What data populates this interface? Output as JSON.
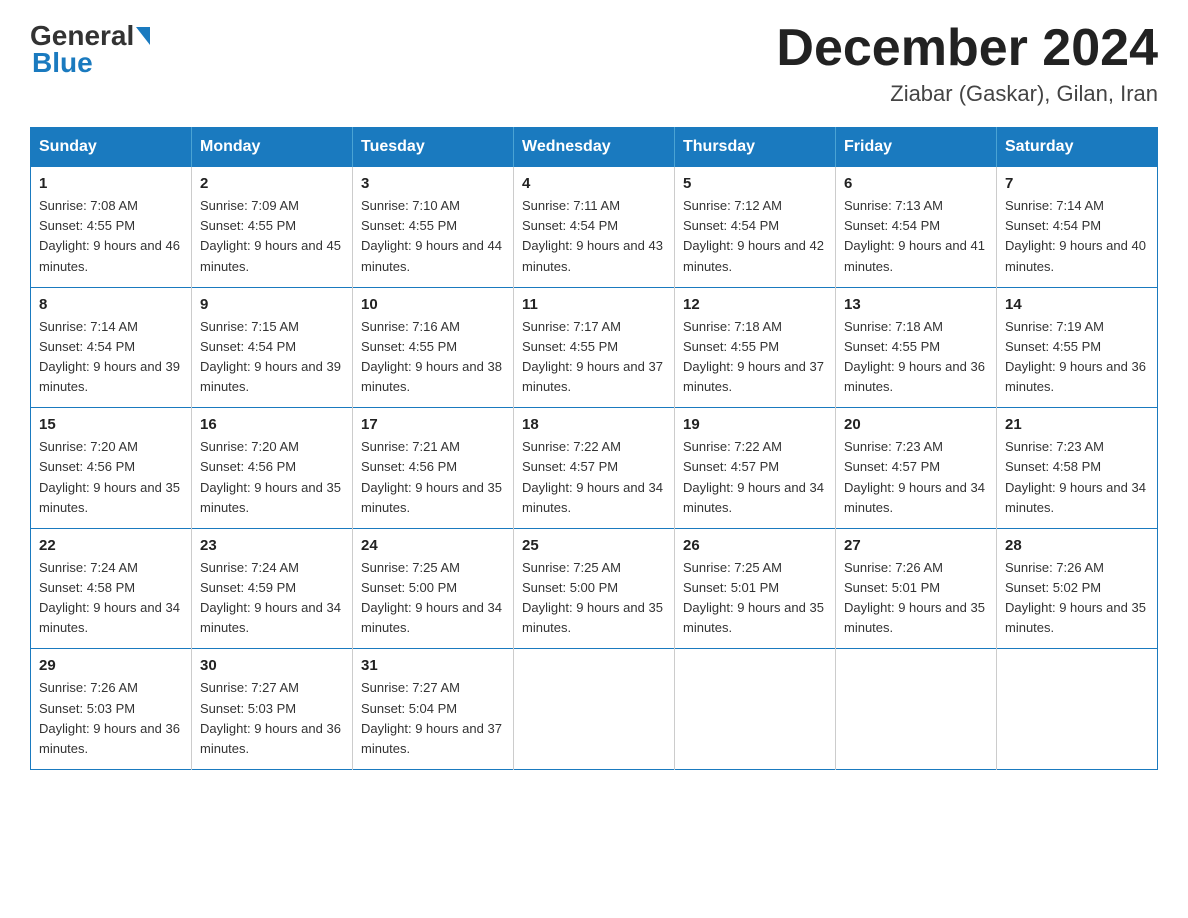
{
  "header": {
    "logo_general": "General",
    "logo_blue": "Blue",
    "month_title": "December 2024",
    "location": "Ziabar (Gaskar), Gilan, Iran"
  },
  "days_of_week": [
    "Sunday",
    "Monday",
    "Tuesday",
    "Wednesday",
    "Thursday",
    "Friday",
    "Saturday"
  ],
  "weeks": [
    [
      {
        "day": "1",
        "sunrise": "7:08 AM",
        "sunset": "4:55 PM",
        "daylight": "9 hours and 46 minutes."
      },
      {
        "day": "2",
        "sunrise": "7:09 AM",
        "sunset": "4:55 PM",
        "daylight": "9 hours and 45 minutes."
      },
      {
        "day": "3",
        "sunrise": "7:10 AM",
        "sunset": "4:55 PM",
        "daylight": "9 hours and 44 minutes."
      },
      {
        "day": "4",
        "sunrise": "7:11 AM",
        "sunset": "4:54 PM",
        "daylight": "9 hours and 43 minutes."
      },
      {
        "day": "5",
        "sunrise": "7:12 AM",
        "sunset": "4:54 PM",
        "daylight": "9 hours and 42 minutes."
      },
      {
        "day": "6",
        "sunrise": "7:13 AM",
        "sunset": "4:54 PM",
        "daylight": "9 hours and 41 minutes."
      },
      {
        "day": "7",
        "sunrise": "7:14 AM",
        "sunset": "4:54 PM",
        "daylight": "9 hours and 40 minutes."
      }
    ],
    [
      {
        "day": "8",
        "sunrise": "7:14 AM",
        "sunset": "4:54 PM",
        "daylight": "9 hours and 39 minutes."
      },
      {
        "day": "9",
        "sunrise": "7:15 AM",
        "sunset": "4:54 PM",
        "daylight": "9 hours and 39 minutes."
      },
      {
        "day": "10",
        "sunrise": "7:16 AM",
        "sunset": "4:55 PM",
        "daylight": "9 hours and 38 minutes."
      },
      {
        "day": "11",
        "sunrise": "7:17 AM",
        "sunset": "4:55 PM",
        "daylight": "9 hours and 37 minutes."
      },
      {
        "day": "12",
        "sunrise": "7:18 AM",
        "sunset": "4:55 PM",
        "daylight": "9 hours and 37 minutes."
      },
      {
        "day": "13",
        "sunrise": "7:18 AM",
        "sunset": "4:55 PM",
        "daylight": "9 hours and 36 minutes."
      },
      {
        "day": "14",
        "sunrise": "7:19 AM",
        "sunset": "4:55 PM",
        "daylight": "9 hours and 36 minutes."
      }
    ],
    [
      {
        "day": "15",
        "sunrise": "7:20 AM",
        "sunset": "4:56 PM",
        "daylight": "9 hours and 35 minutes."
      },
      {
        "day": "16",
        "sunrise": "7:20 AM",
        "sunset": "4:56 PM",
        "daylight": "9 hours and 35 minutes."
      },
      {
        "day": "17",
        "sunrise": "7:21 AM",
        "sunset": "4:56 PM",
        "daylight": "9 hours and 35 minutes."
      },
      {
        "day": "18",
        "sunrise": "7:22 AM",
        "sunset": "4:57 PM",
        "daylight": "9 hours and 34 minutes."
      },
      {
        "day": "19",
        "sunrise": "7:22 AM",
        "sunset": "4:57 PM",
        "daylight": "9 hours and 34 minutes."
      },
      {
        "day": "20",
        "sunrise": "7:23 AM",
        "sunset": "4:57 PM",
        "daylight": "9 hours and 34 minutes."
      },
      {
        "day": "21",
        "sunrise": "7:23 AM",
        "sunset": "4:58 PM",
        "daylight": "9 hours and 34 minutes."
      }
    ],
    [
      {
        "day": "22",
        "sunrise": "7:24 AM",
        "sunset": "4:58 PM",
        "daylight": "9 hours and 34 minutes."
      },
      {
        "day": "23",
        "sunrise": "7:24 AM",
        "sunset": "4:59 PM",
        "daylight": "9 hours and 34 minutes."
      },
      {
        "day": "24",
        "sunrise": "7:25 AM",
        "sunset": "5:00 PM",
        "daylight": "9 hours and 34 minutes."
      },
      {
        "day": "25",
        "sunrise": "7:25 AM",
        "sunset": "5:00 PM",
        "daylight": "9 hours and 35 minutes."
      },
      {
        "day": "26",
        "sunrise": "7:25 AM",
        "sunset": "5:01 PM",
        "daylight": "9 hours and 35 minutes."
      },
      {
        "day": "27",
        "sunrise": "7:26 AM",
        "sunset": "5:01 PM",
        "daylight": "9 hours and 35 minutes."
      },
      {
        "day": "28",
        "sunrise": "7:26 AM",
        "sunset": "5:02 PM",
        "daylight": "9 hours and 35 minutes."
      }
    ],
    [
      {
        "day": "29",
        "sunrise": "7:26 AM",
        "sunset": "5:03 PM",
        "daylight": "9 hours and 36 minutes."
      },
      {
        "day": "30",
        "sunrise": "7:27 AM",
        "sunset": "5:03 PM",
        "daylight": "9 hours and 36 minutes."
      },
      {
        "day": "31",
        "sunrise": "7:27 AM",
        "sunset": "5:04 PM",
        "daylight": "9 hours and 37 minutes."
      },
      null,
      null,
      null,
      null
    ]
  ]
}
